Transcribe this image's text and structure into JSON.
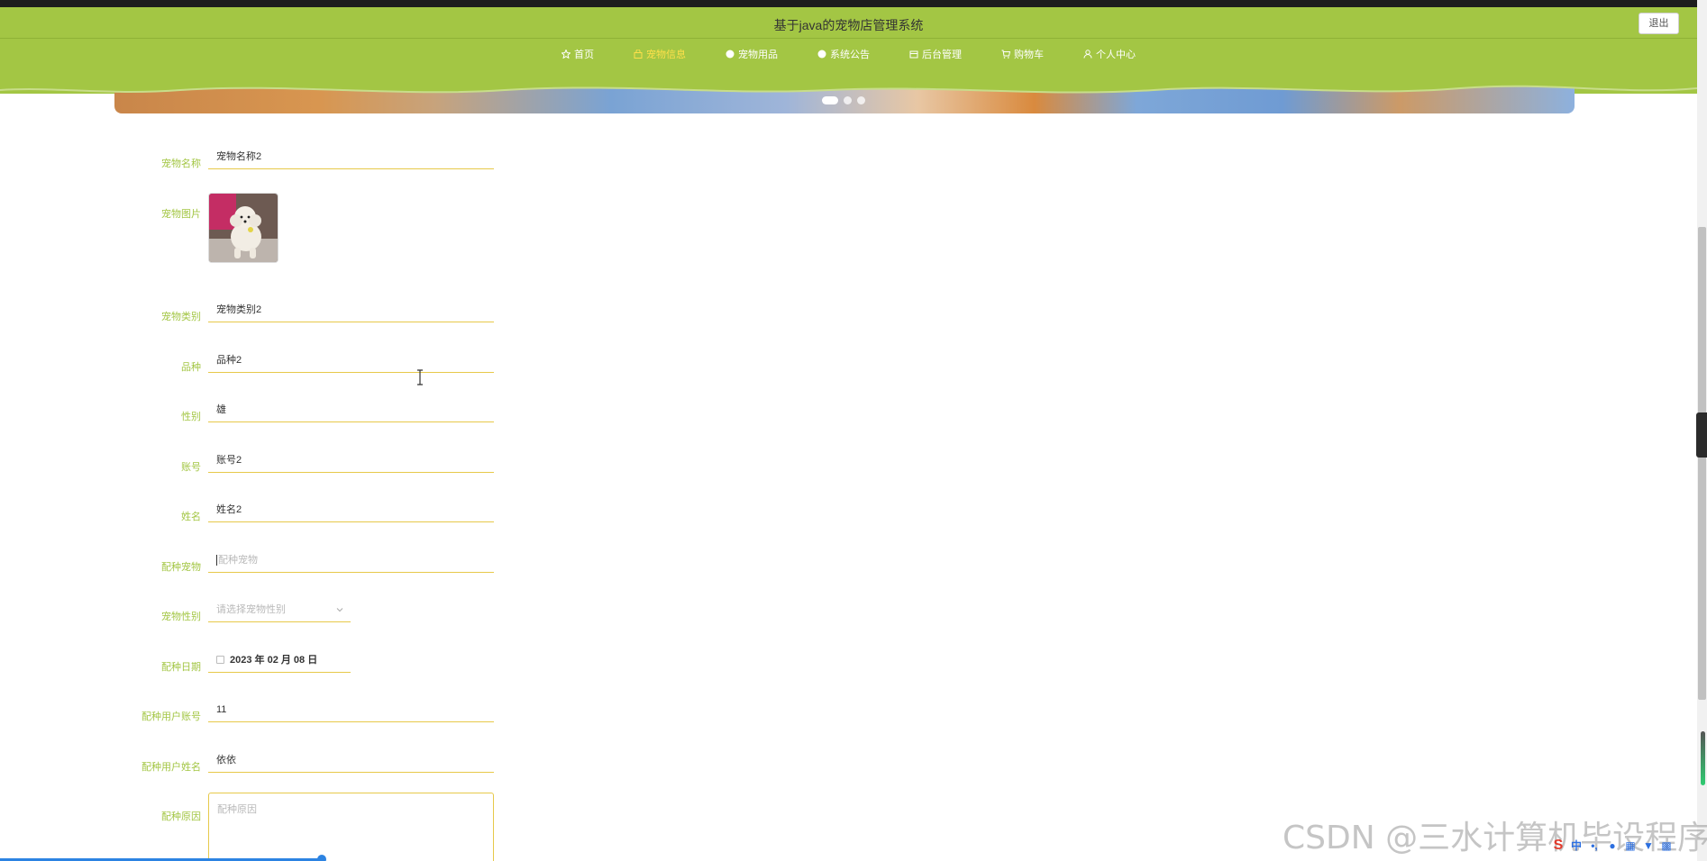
{
  "header": {
    "title": "基于java的宠物店管理系统",
    "logout_label": "退出"
  },
  "nav": {
    "items": [
      {
        "label": "首页",
        "icon": "star-icon"
      },
      {
        "label": "宠物信息",
        "icon": "bag-icon",
        "active": true
      },
      {
        "label": "宠物用品",
        "icon": "circle-icon"
      },
      {
        "label": "系统公告",
        "icon": "circle-icon"
      },
      {
        "label": "后台管理",
        "icon": "box-icon"
      },
      {
        "label": "购物车",
        "icon": "cart-icon"
      },
      {
        "label": "个人中心",
        "icon": "user-icon"
      }
    ]
  },
  "form": {
    "pet_name": {
      "label": "宠物名称",
      "value": "宠物名称2"
    },
    "pet_image": {
      "label": "宠物图片"
    },
    "pet_category": {
      "label": "宠物类别",
      "value": "宠物类别2"
    },
    "breed": {
      "label": "品种",
      "value": "品种2"
    },
    "gender": {
      "label": "性别",
      "value": "雄"
    },
    "account": {
      "label": "账号",
      "value": "账号2"
    },
    "name": {
      "label": "姓名",
      "value": "姓名2"
    },
    "breeding_pet": {
      "label": "配种宠物",
      "placeholder": "配种宠物"
    },
    "pet_gender": {
      "label": "宠物性别",
      "placeholder": "请选择宠物性别"
    },
    "breeding_date": {
      "label": "配种日期",
      "value": "2023 年 02 月 08 日"
    },
    "breeding_user_account": {
      "label": "配种用户账号",
      "value": "11"
    },
    "breeding_user_name": {
      "label": "配种用户姓名",
      "value": "依依"
    },
    "breeding_reason": {
      "label": "配种原因",
      "placeholder": "配种原因"
    }
  },
  "watermark": "CSDN @三水计算机毕设程序",
  "colors": {
    "header_bg": "#a3c644",
    "label": "#a3c644",
    "active_nav": "#ffe04a",
    "field_underline": "#e7c94a"
  }
}
